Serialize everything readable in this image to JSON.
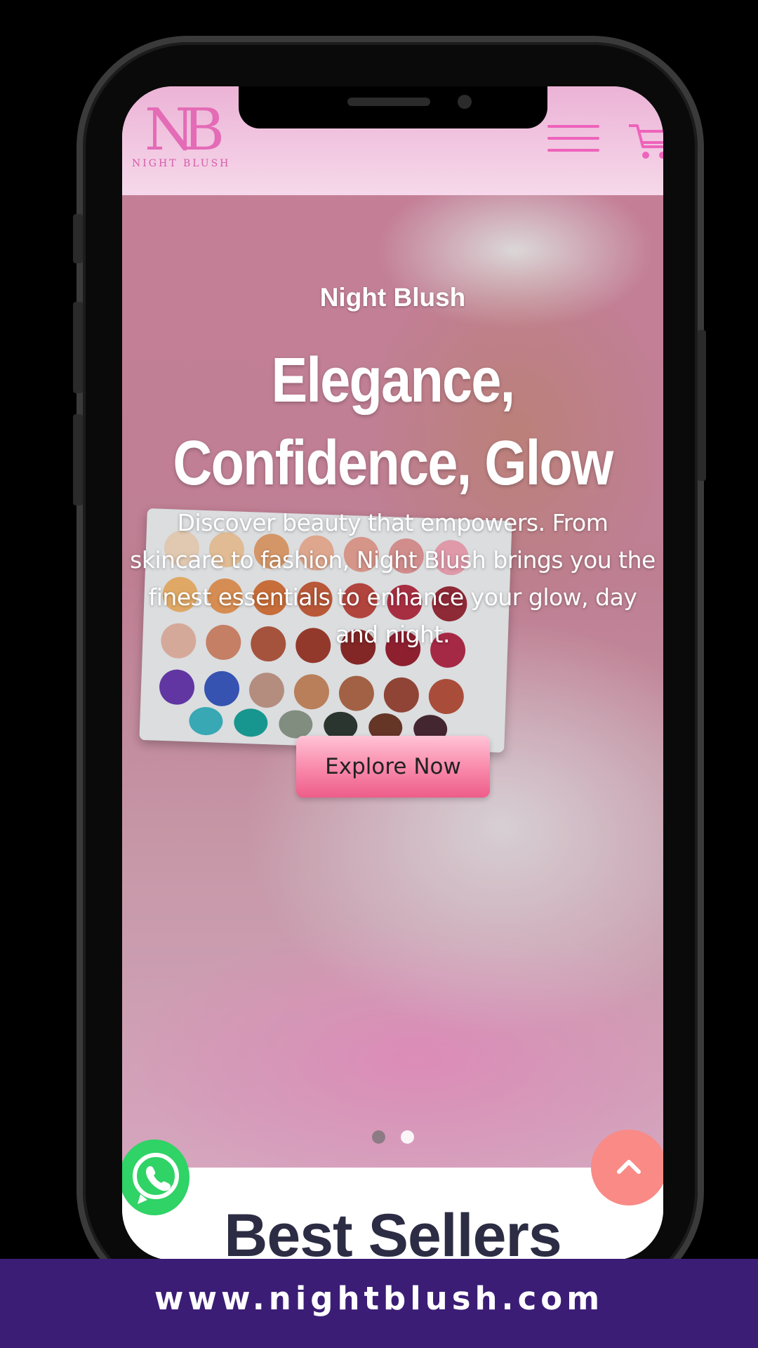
{
  "header": {
    "logo_monogram": "NB",
    "logo_text": "NIGHT BLUSH",
    "menu_icon": "hamburger-icon",
    "cart_icon": "cart-icon"
  },
  "hero": {
    "eyebrow": "Night Blush",
    "title_line1": "Elegance,",
    "title_line2": "Confidence, Glow",
    "description": "Discover beauty that empowers. From skincare to fashion, Night Blush brings you the finest essentials to enhance your glow, day and night.",
    "cta_label": "Explore Now",
    "slides": 2,
    "active_slide": 2
  },
  "section": {
    "title": "Best Sellers"
  },
  "floating": {
    "whatsapp_icon": "whatsapp-icon",
    "scroll_top_icon": "chevron-up-icon"
  },
  "banner": {
    "url": "www.nightblush.com"
  },
  "colors": {
    "brand_pink": "#ee63bb",
    "cta_pink": "#fa91b1",
    "whatsapp_green": "#2fd366",
    "scroll_top": "#f98a86",
    "banner_purple": "#3b1d76",
    "heading_dark": "#2c2c44"
  }
}
